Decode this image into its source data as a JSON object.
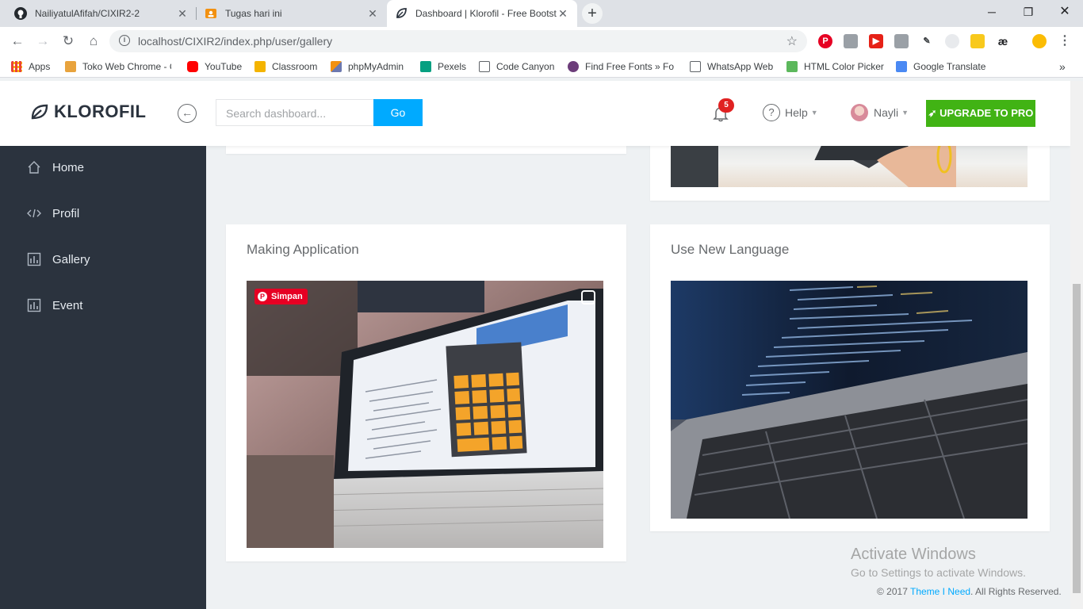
{
  "browser": {
    "tabs": [
      {
        "title": "NailiyatulAfifah/CIXIR2-2",
        "icon": "github-icon"
      },
      {
        "title": "Tugas hari ini",
        "icon": "classroom-icon"
      },
      {
        "title": "Dashboard | Klorofil - Free Bootst",
        "icon": "klorofil-icon"
      }
    ],
    "new_tab": "+",
    "url": "localhost/CIXIR2/index.php/user/gallery",
    "bookmarks": [
      {
        "label": "Apps",
        "color": "#4285f4"
      },
      {
        "label": "Toko Web Chrome - C",
        "color": "#e8a33d"
      },
      {
        "label": "YouTube",
        "color": "#ff0000"
      },
      {
        "label": "Classroom",
        "color": "#f4b400"
      },
      {
        "label": "phpMyAdmin",
        "color": "#f29111"
      },
      {
        "label": "Pexels",
        "color": "#05a081"
      },
      {
        "label": "Code Canyon",
        "color": "#ffffff"
      },
      {
        "label": "Find Free Fonts » Fon",
        "color": "#6c3d7a"
      },
      {
        "label": "WhatsApp Web",
        "color": "#ffffff"
      },
      {
        "label": "HTML Color Picker",
        "color": "#5cb85c"
      },
      {
        "label": "Google Translate",
        "color": "#4a89f3"
      }
    ]
  },
  "header": {
    "logo": "KLOROFIL",
    "search_placeholder": "Search dashboard...",
    "go_label": "Go",
    "notification_count": "5",
    "help_label": "Help",
    "user_name": "Nayli",
    "upgrade_label": "UPGRADE TO PRO"
  },
  "sidebar": {
    "items": [
      {
        "label": "Home",
        "icon": "home-icon"
      },
      {
        "label": "Profil",
        "icon": "code-icon"
      },
      {
        "label": "Gallery",
        "icon": "chart-icon"
      },
      {
        "label": "Event",
        "icon": "chart-icon"
      }
    ]
  },
  "gallery": {
    "panels": [
      {
        "title": "Making Application"
      },
      {
        "title": "Use New Language"
      }
    ],
    "pin_label": "Simpan"
  },
  "watermark": {
    "line1": "Activate Windows",
    "line2": "Go to Settings to activate Windows."
  },
  "footer": {
    "prefix": "© 2017 ",
    "link": "Theme I Need",
    "suffix": ". All Rights Reserved."
  },
  "colors": {
    "sidebar_bg": "#2b333e",
    "accent_blue": "#00aaff",
    "upgrade_green": "#41b314",
    "badge_red": "#e02222"
  }
}
